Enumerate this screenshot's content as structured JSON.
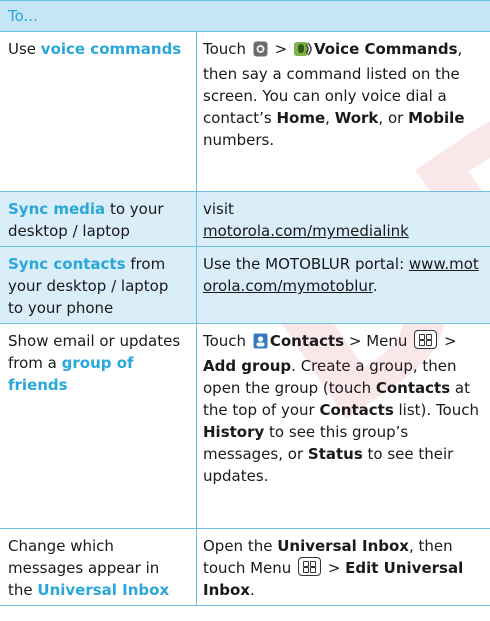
{
  "watermark": "DRAFT",
  "header": {
    "title": "To..."
  },
  "rows": [
    {
      "col1": {
        "t1": "Use ",
        "h1": "voice commands"
      },
      "col2": {
        "t1": "Touch ",
        "sep": " > ",
        "h1": "Voice Commands",
        "t2": ", then say a command listed on the screen. You can only voice dial a contact’s ",
        "h2": "Home",
        "t3": ", ",
        "h3": "Work",
        "t4": ", or ",
        "h4": "Mobile",
        "t5": " numbers."
      }
    },
    {
      "col1": {
        "h1": "Sync media",
        "t1": " to your desktop / laptop"
      },
      "col2": {
        "t1": "visit",
        "link": "motorola.com/mymedialink"
      }
    },
    {
      "col1": {
        "h1": "Sync contacts",
        "t1": " from your desktop / laptop to your phone"
      },
      "col2": {
        "t1": "Use the MOTOBLUR portal: ",
        "link": "www.motorola.com/mymotoblur",
        "t2": "."
      }
    },
    {
      "col1": {
        "t1": "Show email or updates from a ",
        "h1": "group of friends"
      },
      "col2": {
        "t1": "Touch ",
        "h1": "Contacts",
        "t2": " > Menu ",
        "t3": " > ",
        "h2": "Add group",
        "t4": ". Create a group, then open the group (touch ",
        "h3": "Contacts",
        "t5": " at the top of your ",
        "h4": "Contacts",
        "t6": " list). Touch ",
        "h5": "History",
        "t7": " to see this group’s messages, or ",
        "h6": "Status",
        "t8": " to see their updates."
      }
    },
    {
      "col1": {
        "t1": "Change which messages appear in the ",
        "h1": "Universal Inbox"
      },
      "col2": {
        "t1": "Open the ",
        "h1": "Universal Inbox",
        "t2": ", then touch Menu ",
        "t3": " > ",
        "h2": "Edit Universal Inbox",
        "t4": "."
      }
    }
  ],
  "icons": {
    "launcher": "launcher-icon",
    "voice": "voice-commands-icon",
    "contacts": "contacts-icon",
    "menu": "menu-key-icon"
  },
  "colors": {
    "accent": "#2aa7d9",
    "border": "#6fc2e3",
    "header_bg": "#c5e7f5",
    "row_bg": "#d9eef9"
  }
}
